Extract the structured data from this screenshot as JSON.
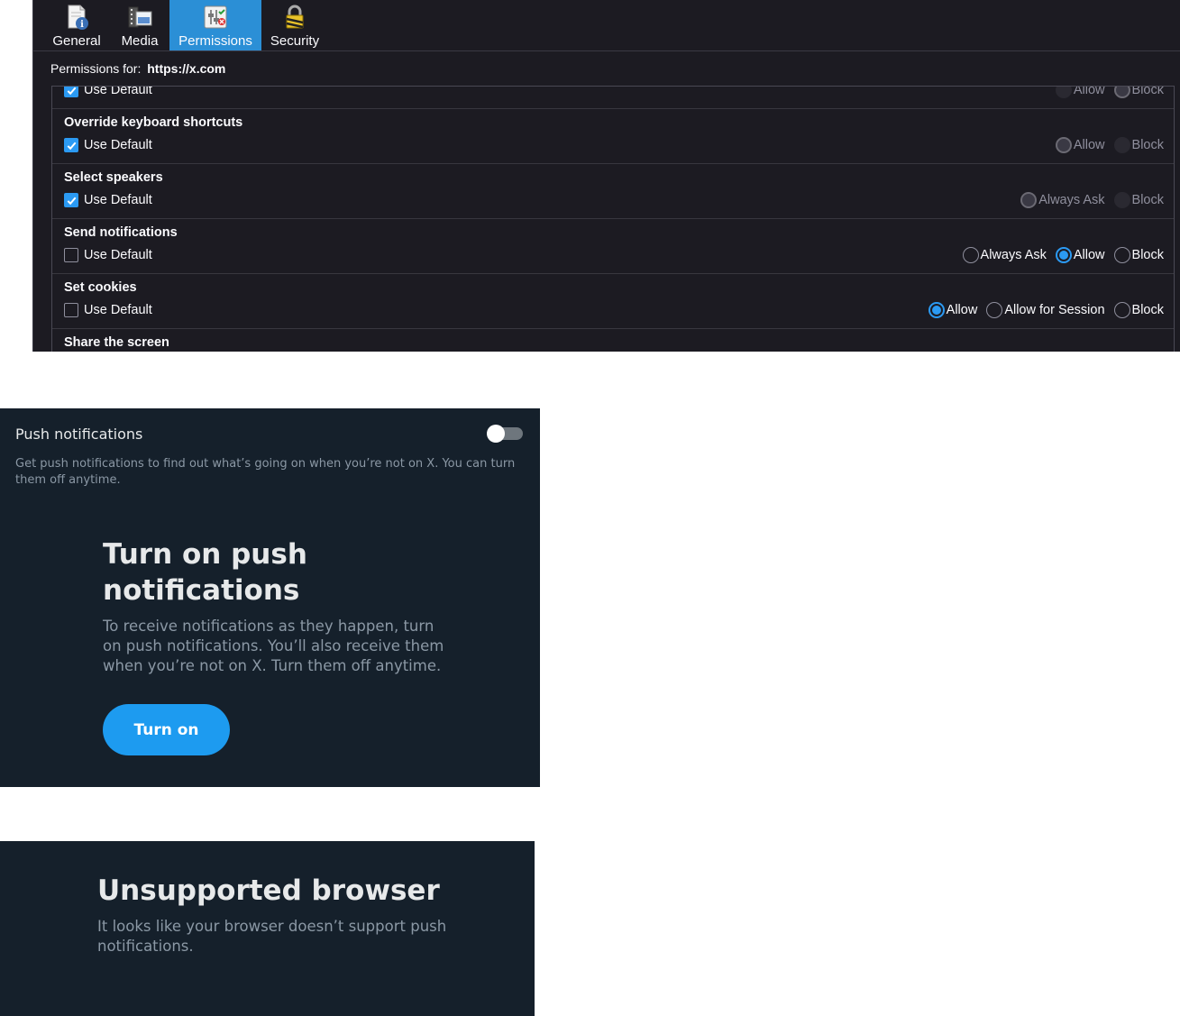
{
  "page_info": {
    "tabs": [
      {
        "label": "General",
        "icon": "document-info-icon"
      },
      {
        "label": "Media",
        "icon": "media-icon"
      },
      {
        "label": "Permissions",
        "icon": "permissions-icon",
        "active": true
      },
      {
        "label": "Security",
        "icon": "lock-icon"
      }
    ],
    "permissions_for_label": "Permissions for:",
    "permissions_for_url": "https://x.com",
    "rows": [
      {
        "title": "",
        "use_default": "Use Default",
        "use_default_checked": true,
        "options": [
          {
            "label": "Allow",
            "state": "dim"
          },
          {
            "label": "Block",
            "state": "grey"
          }
        ],
        "disabled": true
      },
      {
        "title": "Override keyboard shortcuts",
        "use_default": "Use Default",
        "use_default_checked": true,
        "options": [
          {
            "label": "Allow",
            "state": "grey"
          },
          {
            "label": "Block",
            "state": "dim"
          }
        ],
        "disabled": true
      },
      {
        "title": "Select speakers",
        "use_default": "Use Default",
        "use_default_checked": true,
        "options": [
          {
            "label": "Always Ask",
            "state": "grey"
          },
          {
            "label": "Block",
            "state": "dim"
          }
        ],
        "disabled": true
      },
      {
        "title": "Send notifications",
        "use_default": "Use Default",
        "use_default_checked": false,
        "options": [
          {
            "label": "Always Ask",
            "state": "off"
          },
          {
            "label": "Allow",
            "state": "sel"
          },
          {
            "label": "Block",
            "state": "off"
          }
        ],
        "disabled": false
      },
      {
        "title": "Set cookies",
        "use_default": "Use Default",
        "use_default_checked": false,
        "options": [
          {
            "label": "Allow",
            "state": "sel"
          },
          {
            "label": "Allow for Session",
            "state": "off"
          },
          {
            "label": "Block",
            "state": "off"
          }
        ],
        "disabled": false
      },
      {
        "title": "Share the screen",
        "use_default": "",
        "use_default_checked": false,
        "options": [],
        "disabled": false
      }
    ],
    "colors": {
      "accent": "#2b9af3",
      "bg": "#1c1b22",
      "active_tab": "#2b8fd6"
    }
  },
  "push": {
    "title": "Push notifications",
    "toggle_on": false,
    "description": "Get push notifications to find out what’s going on when you’re not on X. You can turn them off anytime.",
    "heading": "Turn on push notifications",
    "body": "To receive notifications as they happen, turn on push notifications. You’ll also receive them when you’re not on X. Turn them off anytime.",
    "button": "Turn on",
    "colors": {
      "bg": "#15202b",
      "button": "#1d9bf0"
    }
  },
  "unsupported": {
    "heading": "Unsupported browser",
    "body": "It looks like your browser doesn’t support push notifications."
  }
}
